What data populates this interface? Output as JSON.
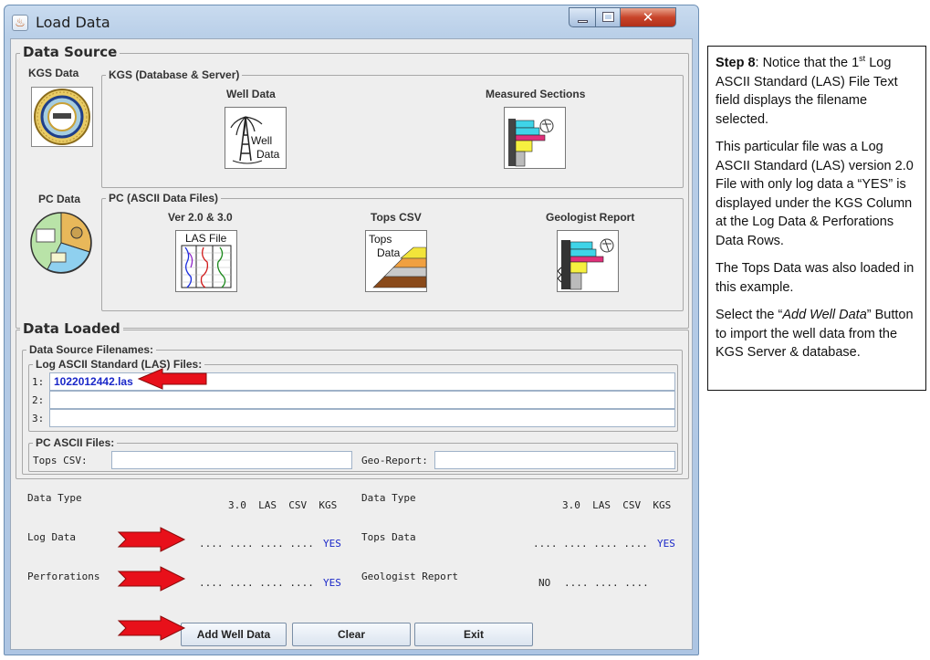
{
  "window": {
    "title": "Load Data"
  },
  "data_source": {
    "title": "Data Source",
    "kgs_data_label": "KGS Data",
    "kgs_group_title": "KGS (Database & Server)",
    "well_data_label": "Well Data",
    "well_icon_text": [
      "Well",
      "Data"
    ],
    "measured_sections_label": "Measured Sections",
    "pc_data_label": "PC Data",
    "pc_group_title": "PC (ASCII Data Files)",
    "las_version_label": "Ver 2.0 & 3.0",
    "las_icon_text": "LAS File",
    "tops_csv_label": "Tops CSV",
    "tops_icon_text": [
      "Tops",
      "Data"
    ],
    "geologist_report_label": "Geologist Report"
  },
  "data_loaded": {
    "title": "Data Loaded",
    "filenames_title": "Data Source Filenames:",
    "las_files_title": "Log ASCII Standard (LAS) Files:",
    "las_rows": [
      {
        "num": "1:",
        "value": "1022012442.las"
      },
      {
        "num": "2:",
        "value": ""
      },
      {
        "num": "3:",
        "value": ""
      }
    ],
    "pc_files_title": "PC ASCII Files:",
    "tops_csv_label": "Tops CSV:",
    "tops_csv_value": "",
    "geo_report_label": "Geo-Report:",
    "geo_report_value": ""
  },
  "status_table": {
    "left": {
      "header": "Data Type",
      "columns": "3.0  LAS  CSV  KGS",
      "rows": [
        {
          "name": "Log Data",
          "dots": ".... .... .... ....",
          "status": "YES"
        },
        {
          "name": "Perforations",
          "dots": ".... .... .... ....",
          "status": "YES"
        }
      ]
    },
    "right": {
      "header": "Data Type",
      "columns": "3.0  LAS  CSV  KGS",
      "rows": [
        {
          "name": "Tops Data",
          "dots": ".... .... .... ....",
          "status": "YES"
        },
        {
          "name": "Geologist Report",
          "status_left": "NO",
          "dots": ".... .... ...."
        }
      ]
    }
  },
  "buttons": {
    "add": "Add Well Data",
    "clear": "Clear",
    "exit": "Exit"
  },
  "note": {
    "step_label": "Step 8",
    "p1_a": ": Notice that the 1",
    "p1_sup": "st",
    "p1_b": " Log ASCII Standard (LAS) File Text field displays the filename selected.",
    "p2": "This particular file was a Log ASCII Standard (LAS) version 2.0 File with only log data a “YES” is displayed under the KGS Column at the Log Data & Perforations Data Rows.",
    "p3": "The Tops Data was also loaded in this example.",
    "p4_a": "Select the “",
    "p4_em": "Add Well Data",
    "p4_b": "” Button to import the well data from the KGS Server & database."
  },
  "colors": {
    "arrow": "#e8101a",
    "yes_text": "#1a27c8",
    "filename_text": "#1a27c8"
  }
}
